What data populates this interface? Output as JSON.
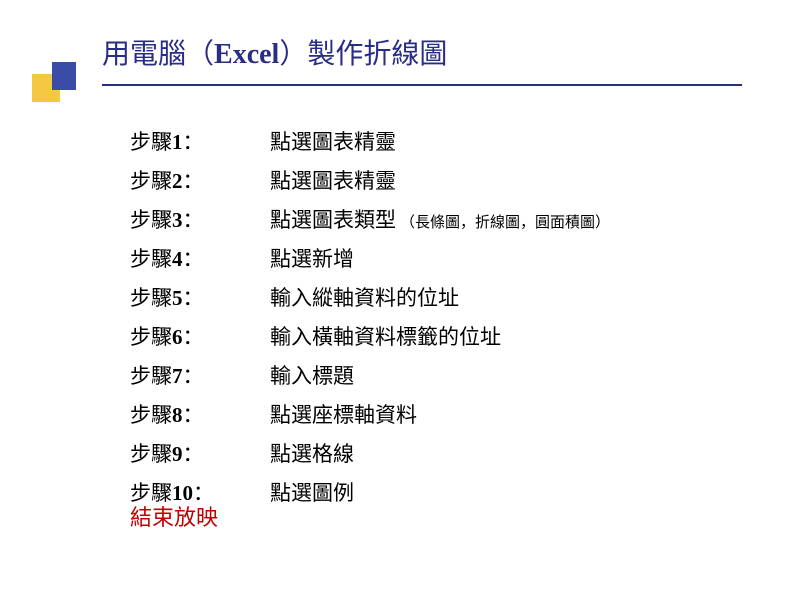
{
  "title": {
    "prefix": "用電腦（",
    "excel": "Excel",
    "suffix": "）製作折線圖"
  },
  "steps": [
    {
      "label": "步驟",
      "num": "1",
      "colon": "：",
      "text": "點選圖表精靈",
      "note": ""
    },
    {
      "label": "步驟",
      "num": "2",
      "colon": "：",
      "text": "點選圖表精靈",
      "note": ""
    },
    {
      "label": "步驟",
      "num": "3",
      "colon": "：",
      "text": "點選圖表類型",
      "note": "（長條圖，折線圖，圓面積圖）"
    },
    {
      "label": "步驟",
      "num": "4",
      "colon": "：",
      "text": "點選新增",
      "note": ""
    },
    {
      "label": "步驟",
      "num": "5",
      "colon": "：",
      "text": "輸入縱軸資料的位址",
      "note": ""
    },
    {
      "label": "步驟",
      "num": "6",
      "colon": "：",
      "text": "輸入橫軸資料標籤的位址",
      "note": ""
    },
    {
      "label": "步驟",
      "num": "7",
      "colon": "：",
      "text": "輸入標題",
      "note": ""
    },
    {
      "label": "步驟",
      "num": "8",
      "colon": "：",
      "text": "點選座標軸資料",
      "note": ""
    },
    {
      "label": "步驟",
      "num": "9",
      "colon": "：",
      "text": "點選格線",
      "note": ""
    },
    {
      "label": "步驟",
      "num": "10",
      "colon": "：",
      "text": "點選圖例",
      "note": ""
    }
  ],
  "end_link": "結束放映"
}
